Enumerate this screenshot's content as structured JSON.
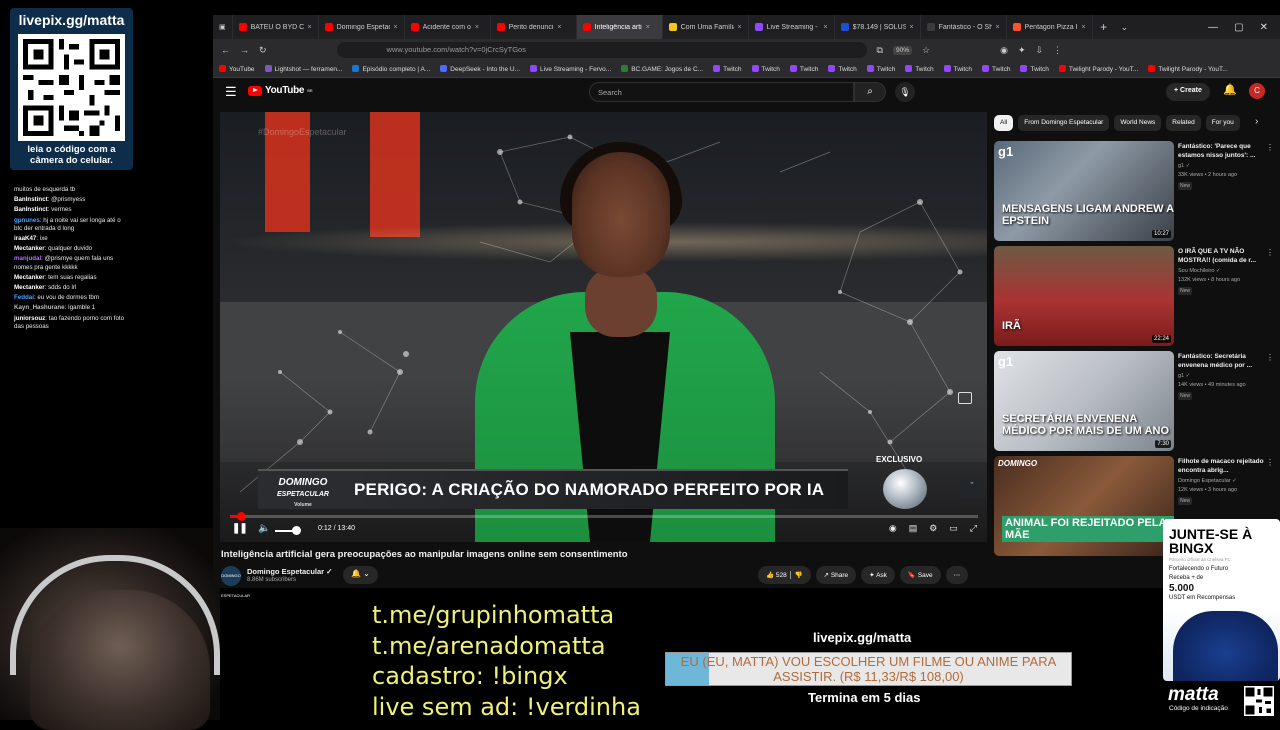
{
  "overlay": {
    "qr_url": "livepix.gg/matta",
    "qr_caption": "leia o código com a câmera do celular.",
    "chat": [
      {
        "user": "",
        "text": "muitos de esquerda tb",
        "color": "#e8e8e8"
      },
      {
        "user": "BanInstinct",
        "text": "@prismyess",
        "color": "#ffffff"
      },
      {
        "user": "BanInstinct",
        "text": "vermes",
        "color": "#ffffff"
      },
      {
        "user": "gpnunes",
        "text": "hj a noite vai ser longa até o btc der entrada d long",
        "color": "#4aa3ff"
      },
      {
        "user": "iraaK47",
        "text": "ixe",
        "color": "#ffffff"
      },
      {
        "user": "Mectanker",
        "text": "qualquer duvido",
        "color": "#ffffff"
      },
      {
        "user": "manjudal",
        "text": "@prismye quem fala uns nomes pra gente kkkkk",
        "color": "#b16cff"
      },
      {
        "user": "Mectanker",
        "text": "tem suas regalias",
        "color": "#ffffff"
      },
      {
        "user": "Mectanker",
        "text": "sdds do lrl",
        "color": "#ffffff"
      },
      {
        "user": "Feddai",
        "text": "eu vou de dormes tbm",
        "color": "#4aa3ff"
      },
      {
        "user": "Kayn_Hashurane",
        "text": "Igamble 1",
        "color": "#bbbbbb"
      },
      {
        "user": "juniorsouz",
        "text": "tao fazendo porno com foto das pessoas",
        "color": "#ffffff"
      }
    ],
    "links": [
      "t.me/grupinhomatta",
      "t.me/arenadomatta",
      "cadastro: !bingx",
      "live sem ad: !verdinha"
    ],
    "donate_url": "livepix.gg/matta",
    "goal_text": "EU (EU, MATTA) VOU ESCOLHER UM FILME OU ANIME PARA ASSISTIR. (R$ 11,33/R$ 108,00)",
    "goal_progress": 0.105,
    "goal_ends": "Termina em 5 dias",
    "bingx": {
      "title": "JUNTE-SE À BINGX",
      "small": "Parceiro Oficial da Chelsea FC",
      "line1": "Fortalecendo o Futuro",
      "line2": "Receba + de",
      "amount": "5.000",
      "line3": "USDT em Recompensas"
    },
    "matta_logo": "matta",
    "matta_sub": "Código de indicação"
  },
  "browser": {
    "tabs": [
      {
        "label": "BATEU O BYD COM",
        "color": "#ff0000",
        "active": false
      },
      {
        "label": "Domingo Espetacul",
        "color": "#ff0000",
        "active": false
      },
      {
        "label": "Acidente com o",
        "color": "#ff0000",
        "active": false
      },
      {
        "label": "Perito denunci",
        "color": "#ff0000",
        "active": false
      },
      {
        "label": "Inteligência arti",
        "color": "#ff0000",
        "active": true
      },
      {
        "label": "Com Uma Família d",
        "color": "#f5c518",
        "active": false
      },
      {
        "label": "Live Streaming - Fe",
        "color": "#9146ff",
        "active": false
      },
      {
        "label": "$78.149 | SOLUSDT",
        "color": "#1e4fd8",
        "active": false
      },
      {
        "label": "Fantástico - O Show",
        "color": "#3b3b3b",
        "active": false
      },
      {
        "label": "Pentagon Pizza Indi",
        "color": "#fb542b",
        "active": false
      }
    ],
    "url": "www.youtube.com/watch?v=0jCrcSyTGos",
    "zoom": "90%",
    "bookmarks": [
      {
        "label": "YouTube",
        "color": "#ff0000"
      },
      {
        "label": "Lightshot — ferramen...",
        "color": "#7e57c2"
      },
      {
        "label": "Episódio completo | A...",
        "color": "#1976d2"
      },
      {
        "label": "DeepSeek - Into the U...",
        "color": "#4d6bfe"
      },
      {
        "label": "Live Streaming - Fervo...",
        "color": "#9146ff"
      },
      {
        "label": "BC.GAME: Jogos de C...",
        "color": "#2e7d32"
      },
      {
        "label": "Twitch",
        "color": "#9146ff"
      },
      {
        "label": "Twitch",
        "color": "#9146ff"
      },
      {
        "label": "Twitch",
        "color": "#9146ff"
      },
      {
        "label": "Twitch",
        "color": "#9146ff"
      },
      {
        "label": "Twitch",
        "color": "#9146ff"
      },
      {
        "label": "Twitch",
        "color": "#9146ff"
      },
      {
        "label": "Twitch",
        "color": "#9146ff"
      },
      {
        "label": "Twitch",
        "color": "#9146ff"
      },
      {
        "label": "Twitch",
        "color": "#9146ff"
      },
      {
        "label": "Twilight Parody - YouT...",
        "color": "#ff0000"
      },
      {
        "label": "Twilight Parody - YouT...",
        "color": "#ff0000"
      }
    ]
  },
  "youtube": {
    "logo": "YouTube",
    "logo_country": "BR",
    "search_placeholder": "Search",
    "create_label": "Create",
    "avatar_letter": "C",
    "player": {
      "watermark": "#DomingoEspetacular",
      "brand_line1": "DOMINGO",
      "brand_line2": "ESPETACULAR",
      "brand_line3": "Volume",
      "headline": "PERIGO: A CRIAÇÃO DO NAMORADO PERFEITO POR IA",
      "exclusivo": "EXCLUSIVO",
      "time": "0:12 / 13:40",
      "progress": 0.015
    },
    "video_title": "Inteligência artificial gera preocupações ao manipular imagens online sem consentimento",
    "channel": {
      "name": "Domingo Espetacular ✓",
      "subs": "8.86M subscribers",
      "avatar_text": "DOMINGO ESPETACULAR"
    },
    "actions": {
      "likes": "528",
      "share": "Share",
      "ask": "Ask",
      "save": "Save"
    },
    "chips": [
      "All",
      "From Domingo Espetacular",
      "World News",
      "Related",
      "For you"
    ],
    "recommendations": [
      {
        "title": "Fantástico: 'Parece que estamos nisso juntos': ...",
        "channel": "g1 ✓",
        "meta": "33K views • 2 hours ago",
        "badge": "New",
        "duration": "10:27",
        "caption": "MENSAGENS LIGAM ANDREW A EPSTEIN",
        "logo": "g1"
      },
      {
        "title": "O IRÃ QUE A TV NÃO MOSTRA!! (comida de r...",
        "channel": "Sou Mochileiro ✓",
        "meta": "132K views • 8 hours ago",
        "badge": "New",
        "duration": "22:24",
        "caption": "IRÃ",
        "logo": ""
      },
      {
        "title": "Fantástico: Secretária envenena médico por ...",
        "channel": "g1 ✓",
        "meta": "14K views • 49 minutes ago",
        "badge": "New",
        "duration": "7:30",
        "caption": "SECRETÁRIA ENVENENA MÉDICO POR MAIS DE UM ANO",
        "logo": "g1"
      },
      {
        "title": "Filhote de macaco rejeitado encontra abrig...",
        "channel": "Domingo Espetacular ✓",
        "meta": "12K views • 3 hours ago",
        "badge": "New",
        "duration": "",
        "caption": "ANIMAL FOI REJEITADO PELA MÃE",
        "logo": "DOMINGO"
      }
    ]
  }
}
